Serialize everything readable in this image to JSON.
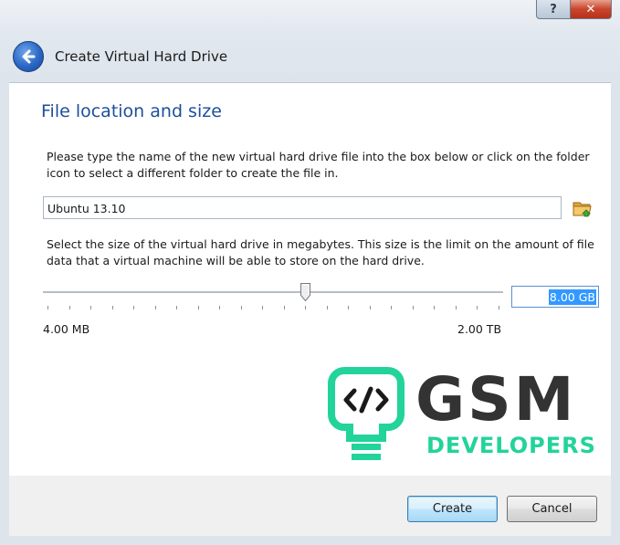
{
  "window": {
    "title": "Create Virtual Hard Drive",
    "help_button": "?",
    "close_button": "✕"
  },
  "content": {
    "heading": "File location and size",
    "location_instructions": "Please type the name of the new virtual hard drive file into the box below or click on the folder icon to select a different folder to create the file in.",
    "file_name_value": "Ubuntu 13.10",
    "size_instructions": "Select the size of the virtual hard drive in megabytes. This size is the limit on the amount of file data that a virtual machine will be able to store on the hard drive.",
    "size_value": "8.00 GB",
    "slider_min_label": "4.00 MB",
    "slider_max_label": "2.00 TB",
    "slider_position_fraction": 0.57,
    "slider_tick_count": 22
  },
  "watermark": {
    "brand_top": "GSM",
    "brand_bottom": "DEVELOPERS",
    "accent_color": "#22d39a"
  },
  "footer": {
    "create_label": "Create",
    "cancel_label": "Cancel"
  },
  "icons": {
    "back": "back-arrow-icon",
    "folder": "folder-open-icon"
  }
}
